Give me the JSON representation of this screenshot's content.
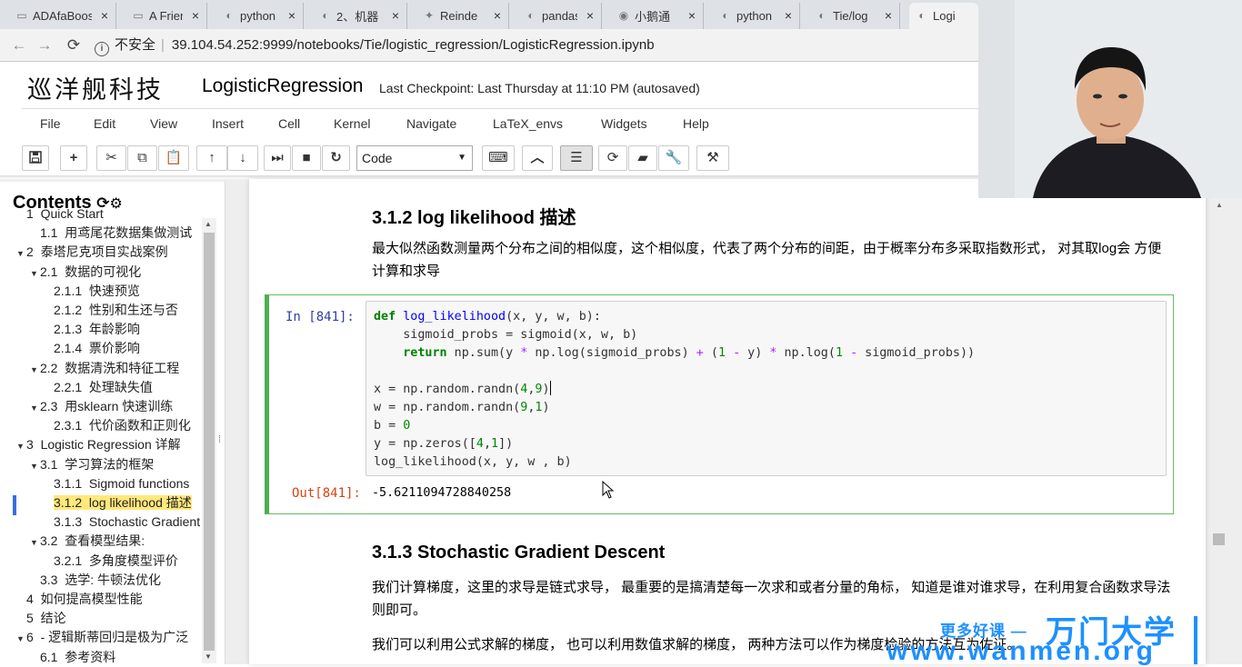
{
  "browser": {
    "tabs": [
      {
        "title": "ADAfaBoost",
        "icon": "document-icon"
      },
      {
        "title": "A Friendly",
        "icon": "document-icon"
      },
      {
        "title": "python",
        "icon": "jupyter-icon"
      },
      {
        "title": "2、机器",
        "icon": "jupyter-icon"
      },
      {
        "title": "Reinde",
        "icon": "github-icon"
      },
      {
        "title": "pandas",
        "icon": "jupyter-icon"
      },
      {
        "title": "小鹅通",
        "icon": "globe-icon"
      },
      {
        "title": "python",
        "icon": "jupyter-icon"
      },
      {
        "title": "Tie/log",
        "icon": "jupyter-icon"
      },
      {
        "title": "Logistic",
        "icon": "jupyter-icon"
      }
    ],
    "security": "不安全",
    "url": "39.104.54.252:9999/notebooks/Tie/logistic_regression/LogisticRegression.ipynb"
  },
  "header": {
    "logo": "巡洋舰科技",
    "notebook_name": "LogisticRegression",
    "checkpoint": "Last Checkpoint: Last Thursday at 11:10 PM (autosaved)"
  },
  "menu": [
    "File",
    "Edit",
    "View",
    "Insert",
    "Cell",
    "Kernel",
    "Navigate",
    "LaTeX_envs",
    "Widgets",
    "Help"
  ],
  "toolbar": {
    "cell_type": "Code"
  },
  "toc": {
    "title": "Contents",
    "items": [
      {
        "num": "1",
        "label": "Quick Start",
        "tri": ""
      },
      {
        "num": "1.1",
        "label": "用鸢尾花数据集做测试",
        "tri": ""
      },
      {
        "num": "2",
        "label": "泰塔尼克项目实战案例",
        "tri": "▼"
      },
      {
        "num": "2.1",
        "label": "数据的可视化",
        "tri": "▼"
      },
      {
        "num": "2.1.1",
        "label": "快速预览",
        "tri": ""
      },
      {
        "num": "2.1.2",
        "label": "性别和生还与否",
        "tri": ""
      },
      {
        "num": "2.1.3",
        "label": "年龄影响",
        "tri": ""
      },
      {
        "num": "2.1.4",
        "label": "票价影响",
        "tri": ""
      },
      {
        "num": "2.2",
        "label": "数据清洗和特征工程",
        "tri": "▼"
      },
      {
        "num": "2.2.1",
        "label": "处理缺失值",
        "tri": ""
      },
      {
        "num": "2.3",
        "label": "用sklearn 快速训练",
        "tri": "▼"
      },
      {
        "num": "2.3.1",
        "label": "代价函数和正则化",
        "tri": ""
      },
      {
        "num": "3",
        "label": "Logistic Regression 详解",
        "tri": "▼"
      },
      {
        "num": "3.1",
        "label": "学习算法的框架",
        "tri": "▼"
      },
      {
        "num": "3.1.1",
        "label": "Sigmoid functions",
        "tri": ""
      },
      {
        "num": "3.1.2",
        "label": "log likelihood 描述",
        "tri": "",
        "active": true
      },
      {
        "num": "3.1.3",
        "label": "Stochastic Gradient Descent",
        "tri": ""
      },
      {
        "num": "3.2",
        "label": "查看模型结果:",
        "tri": "▼"
      },
      {
        "num": "3.2.1",
        "label": "多角度模型评价",
        "tri": ""
      },
      {
        "num": "3.3",
        "label": "选学: 牛顿法优化",
        "tri": ""
      },
      {
        "num": "4",
        "label": "如何提高模型性能",
        "tri": ""
      },
      {
        "num": "5",
        "label": "结论",
        "tri": ""
      },
      {
        "num": "6",
        "label": "- 逻辑斯蒂回归是极为广泛",
        "tri": "▼"
      },
      {
        "num": "6.1",
        "label": "参考资料",
        "tri": ""
      }
    ]
  },
  "notebook": {
    "h_312": "3.1.2 log likelihood 描述",
    "p_312": "最大似然函数测量两个分布之间的相似度，这个相似度，代表了两个分布的间距，由于概率分布多采取指数形式， 对其取log会 方便计算和求导",
    "in_prompt": "In  [841]:",
    "out_prompt": "Out[841]:",
    "output": "-5.6211094728840258",
    "h_313": "3.1.3 Stochastic Gradient Descent",
    "p_313a": "我们计算梯度，这里的求导是链式求导， 最重要的是搞清楚每一次求和或者分量的角标， 知道是谁对谁求导，在利用复合函数求导法则即可。",
    "p_313b": "我们可以利用公式求解的梯度， 也可以利用数值求解的梯度， 两种方法可以作为梯度检验的方法互为佐证。"
  },
  "watermark": {
    "line1": "更多好课 —",
    "line2": "万门大学",
    "line3": "www.wanmen.org"
  }
}
